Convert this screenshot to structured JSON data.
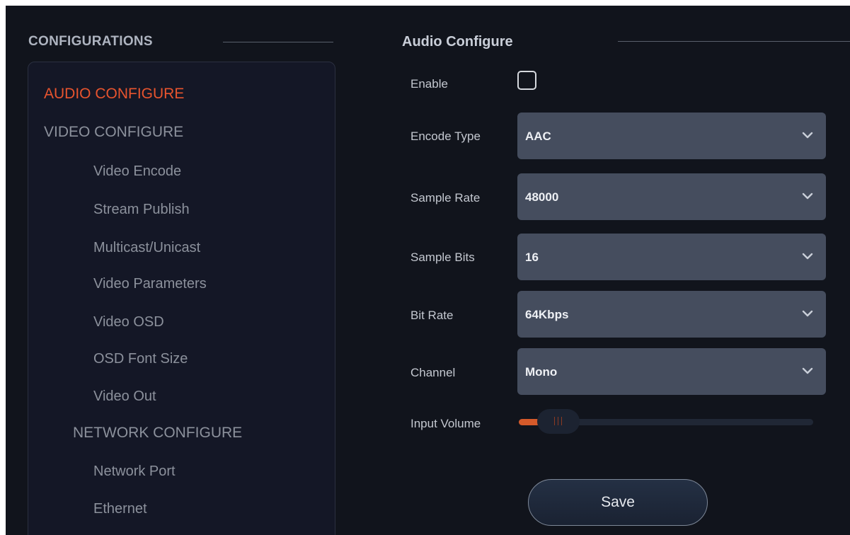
{
  "sidebar": {
    "title": "CONFIGURATIONS",
    "items": [
      {
        "label": "AUDIO CONFIGURE",
        "level": "top",
        "active": true
      },
      {
        "label": "VIDEO CONFIGURE",
        "level": "top",
        "active": false
      },
      {
        "label": "Video Encode",
        "level": "sub",
        "active": false
      },
      {
        "label": "Stream Publish",
        "level": "sub",
        "active": false
      },
      {
        "label": "Multicast/Unicast",
        "level": "sub",
        "active": false
      },
      {
        "label": "Video Parameters",
        "level": "sub",
        "active": false
      },
      {
        "label": "Video OSD",
        "level": "sub",
        "active": false
      },
      {
        "label": "OSD Font Size",
        "level": "sub",
        "active": false
      },
      {
        "label": "Video Out",
        "level": "sub",
        "active": false
      },
      {
        "label": "NETWORK CONFIGURE",
        "level": "top",
        "active": false
      },
      {
        "label": "Network Port",
        "level": "sub",
        "active": false
      },
      {
        "label": "Ethernet",
        "level": "sub",
        "active": false
      }
    ]
  },
  "main": {
    "title": "Audio Configure",
    "enable": {
      "label": "Enable",
      "checked": false
    },
    "fields": [
      {
        "label": "Encode Type",
        "value": "AAC"
      },
      {
        "label": "Sample Rate",
        "value": "48000"
      },
      {
        "label": "Sample Bits",
        "value": "16"
      },
      {
        "label": "Bit Rate",
        "value": "64Kbps"
      },
      {
        "label": "Channel",
        "value": "Mono"
      }
    ],
    "input_volume": {
      "label": "Input Volume"
    },
    "save_label": "Save"
  },
  "colors": {
    "background": "#11141c",
    "active_accent": "#e8542e",
    "select_bg": "#454d5e",
    "slider_fill": "#d55a2a"
  },
  "icons": {
    "dropdown": "chevron-down-icon",
    "enable": "checkbox-icon"
  }
}
